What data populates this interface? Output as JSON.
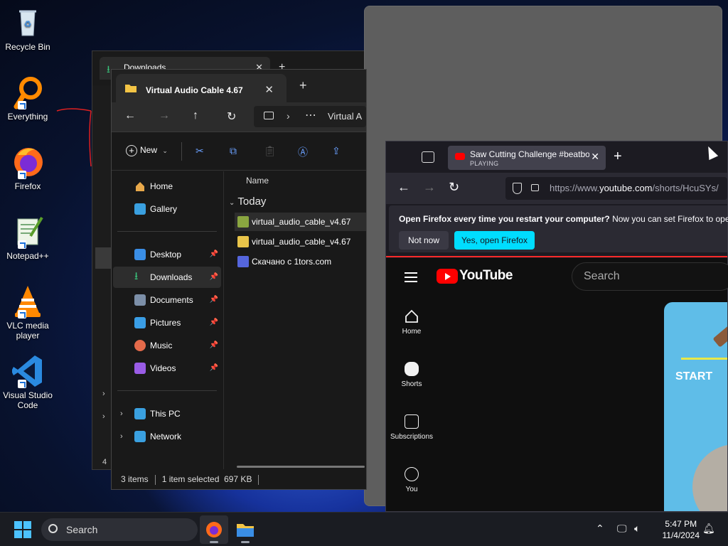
{
  "desktop": {
    "icons": [
      {
        "label": "Recycle Bin",
        "icon": "recycle-bin-icon"
      },
      {
        "label": "Everything",
        "icon": "everything-search-icon"
      },
      {
        "label": "Firefox",
        "icon": "firefox-icon"
      },
      {
        "label": "Notepad++",
        "icon": "notepadpp-icon"
      },
      {
        "label": "VLC media player",
        "icon": "vlc-icon"
      },
      {
        "label": "Visual Studio Code",
        "icon": "vscode-icon"
      }
    ]
  },
  "explorer_back": {
    "tab_title": "Downloads",
    "status_fragment": "4"
  },
  "explorer": {
    "tab_title": "Virtual Audio Cable 4.67",
    "address": {
      "crumb": "Virtual A"
    },
    "commands": {
      "new_label": "New"
    },
    "nav_pane": {
      "quick": [
        {
          "label": "Home",
          "icon": "home-icon",
          "color": "#e8a84a"
        },
        {
          "label": "Gallery",
          "icon": "gallery-icon",
          "color": "#3aa0e0"
        }
      ],
      "pinned": [
        {
          "label": "Desktop",
          "icon": "desktop-folder-icon",
          "color": "#3a8ee6"
        },
        {
          "label": "Downloads",
          "icon": "downloads-folder-icon",
          "color": "#39c27a"
        },
        {
          "label": "Documents",
          "icon": "documents-folder-icon",
          "color": "#7c8fa8"
        },
        {
          "label": "Pictures",
          "icon": "pictures-folder-icon",
          "color": "#3a9ee6"
        },
        {
          "label": "Music",
          "icon": "music-folder-icon",
          "color": "#e46a4a"
        },
        {
          "label": "Videos",
          "icon": "videos-folder-icon",
          "color": "#9a5ce6"
        }
      ],
      "pin_glyph": "📌",
      "locations": [
        {
          "label": "This PC",
          "icon": "this-pc-icon",
          "color": "#3aa0e0"
        },
        {
          "label": "Network",
          "icon": "network-icon",
          "color": "#3aa0e0"
        }
      ]
    },
    "files": {
      "column_name": "Name",
      "group": "Today",
      "rows": [
        {
          "name": "virtual_audio_cable_v4.67",
          "icon": "setup-exe-icon",
          "color": "#8aa640"
        },
        {
          "name": "virtual_audio_cable_v4.67",
          "icon": "zip-folder-icon",
          "color": "#e8c44a"
        },
        {
          "name": "Скачано с 1tors.com",
          "icon": "url-shortcut-icon",
          "color": "#5566dd"
        }
      ]
    },
    "status": {
      "items": "3 items",
      "selected": "1 item selected",
      "size": "697 KB"
    }
  },
  "firefox": {
    "tab": {
      "title": "Saw Cutting Challenge #beatbo",
      "state": "PLAYING"
    },
    "url": {
      "prefix": "https://www.",
      "host": "youtube.com",
      "path": "/shorts/HcuSYs/"
    },
    "notice": {
      "bold": "Open Firefox every time you restart your computer?",
      "text": " Now you can set Firefox to open",
      "not_now": "Not now",
      "yes": "Yes, open Firefox"
    },
    "youtube": {
      "logo": "YouTube",
      "search_placeholder": "Search",
      "sidebar": [
        {
          "label": "Home",
          "icon": "yt-home-icon"
        },
        {
          "label": "Shorts",
          "icon": "yt-shorts-icon"
        },
        {
          "label": "Subscriptions",
          "icon": "yt-subscriptions-icon"
        },
        {
          "label": "You",
          "icon": "yt-you-icon"
        }
      ],
      "video_overlay": "START"
    }
  },
  "taskbar": {
    "search": "Search",
    "time": "5:47 PM",
    "date": "11/4/2024"
  },
  "colors": {
    "accent": "#4cc2ff",
    "firefox_primary": "#00ddff",
    "youtube_red": "#ff0000"
  }
}
